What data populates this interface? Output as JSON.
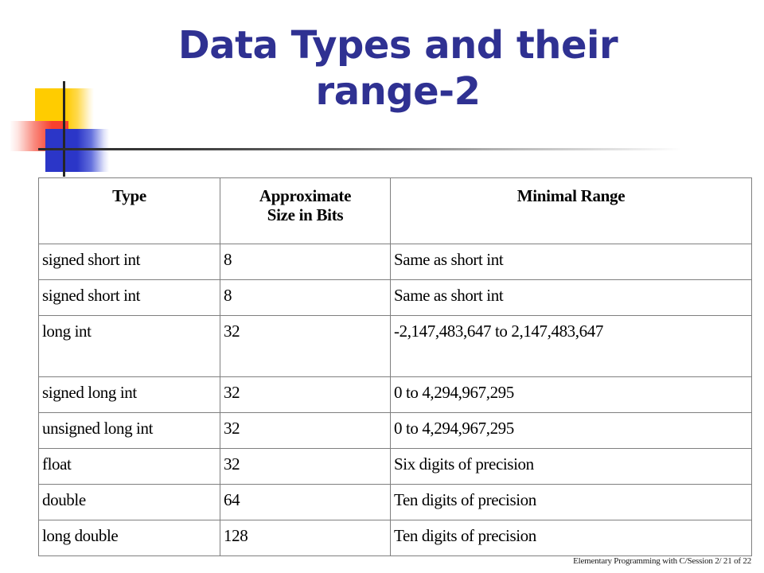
{
  "slide": {
    "title": "Data Types and their\nrange-2",
    "title_color": "#2f3192",
    "footer": "Elementary Programming with C/Session 2/ 21 of 22"
  },
  "decoration": {
    "name": "powerpoint-accent-graphic",
    "yellow": "#ffcc00",
    "red": "#f8402e",
    "blue": "#2b36c8",
    "line": "#262626"
  },
  "table": {
    "border_color": "#7f7f7f",
    "headers": {
      "type": "Type",
      "size_line1": "Approximate",
      "size_line2": "Size in Bits",
      "range": "Minimal Range"
    },
    "rows": [
      {
        "type": "signed short int",
        "size": "8",
        "range": "Same as short int"
      },
      {
        "type": "signed short int",
        "size": "8",
        "range": "Same as short int"
      },
      {
        "type": "long int",
        "size": "32",
        "range": "-2,147,483,647 to 2,147,483,647"
      },
      {
        "type": "signed long int",
        "size": "32",
        "range": "0 to 4,294,967,295"
      },
      {
        "type": "unsigned long int",
        "size": "32",
        "range": "0 to 4,294,967,295"
      },
      {
        "type": "float",
        "size": "32",
        "range": "Six digits of precision"
      },
      {
        "type": "double",
        "size": "64",
        "range": "Ten digits of precision"
      },
      {
        "type": "long double",
        "size": "128",
        "range": "Ten digits of precision"
      }
    ]
  }
}
